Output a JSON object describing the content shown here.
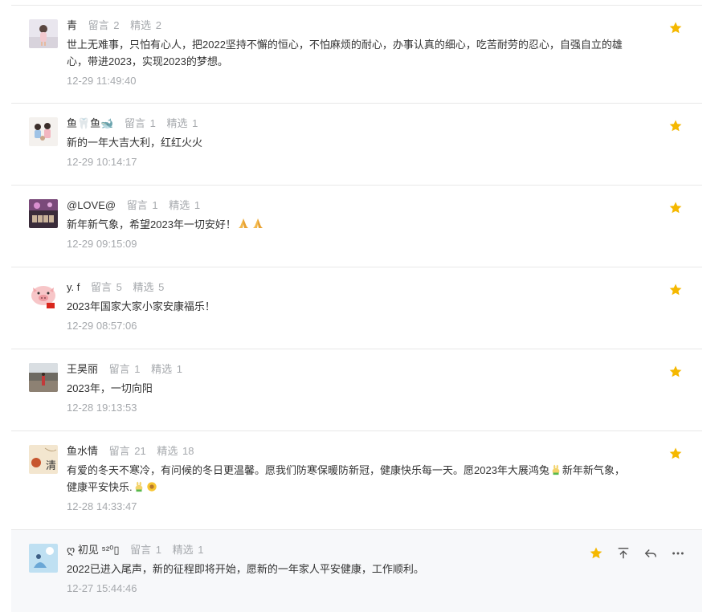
{
  "labels": {
    "liuyan": "留言",
    "jingxuan": "精选"
  },
  "colors": {
    "star": "#f5b800",
    "meta": "#a6a9ad",
    "text": "#333333",
    "divider": "#e8e8e8",
    "hover_bg": "#f7f8fa"
  },
  "comments": [
    {
      "name": "青",
      "liuyan": "2",
      "jingxuan": "2",
      "text": "世上无难事，只怕有心人，把2022坚持不懈的恒心，不怕麻烦的耐心，办事认真的细心，吃苦耐劳的忍心，自强自立的雄心，带进2023，实现2023的梦想。",
      "time": "12-29 11:49:40",
      "starred": true
    },
    {
      "name": "鱼🦷鱼🐋",
      "liuyan": "1",
      "jingxuan": "1",
      "text": "新的一年大吉大利，红红火火",
      "time": "12-29 10:14:17",
      "starred": true
    },
    {
      "name": "@LOVE@",
      "liuyan": "1",
      "jingxuan": "1",
      "text": "新年新气象，希望2023年一切安好！",
      "text_suffix_icons": [
        "pray-emoji",
        "pray-emoji"
      ],
      "time": "12-29 09:15:09",
      "starred": true
    },
    {
      "name": "y. f",
      "liuyan": "5",
      "jingxuan": "5",
      "text": "2023年国家大家小家安康福乐！",
      "time": "12-29 08:57:06",
      "starred": true
    },
    {
      "name": "王昊丽",
      "liuyan": "1",
      "jingxuan": "1",
      "text": "2023年，一切向阳",
      "time": "12-28 19:13:53",
      "starred": true
    },
    {
      "name": "鱼水情",
      "liuyan": "21",
      "jingxuan": "18",
      "text_parts": [
        "有爱的冬天不寒冷，有问候的冬日更温馨。愿我们防寒保暖防新冠，健康快乐每一天。愿2023年大展鸿兔",
        "新年新气象，健康平安快乐."
      ],
      "text_icons": [
        "rabbit-emoji",
        "rabbit-emoji",
        "sunflower-emoji"
      ],
      "time": "12-28 14:33:47",
      "starred": true
    },
    {
      "name": "ღ 初见 ⁵²⁰▯",
      "liuyan": "1",
      "jingxuan": "1",
      "text": "2022已进入尾声，新的征程即将开始，愿新的一年家人平安健康，工作顺利。",
      "time": "12-27 15:44:46",
      "starred": true,
      "hover": true
    }
  ]
}
